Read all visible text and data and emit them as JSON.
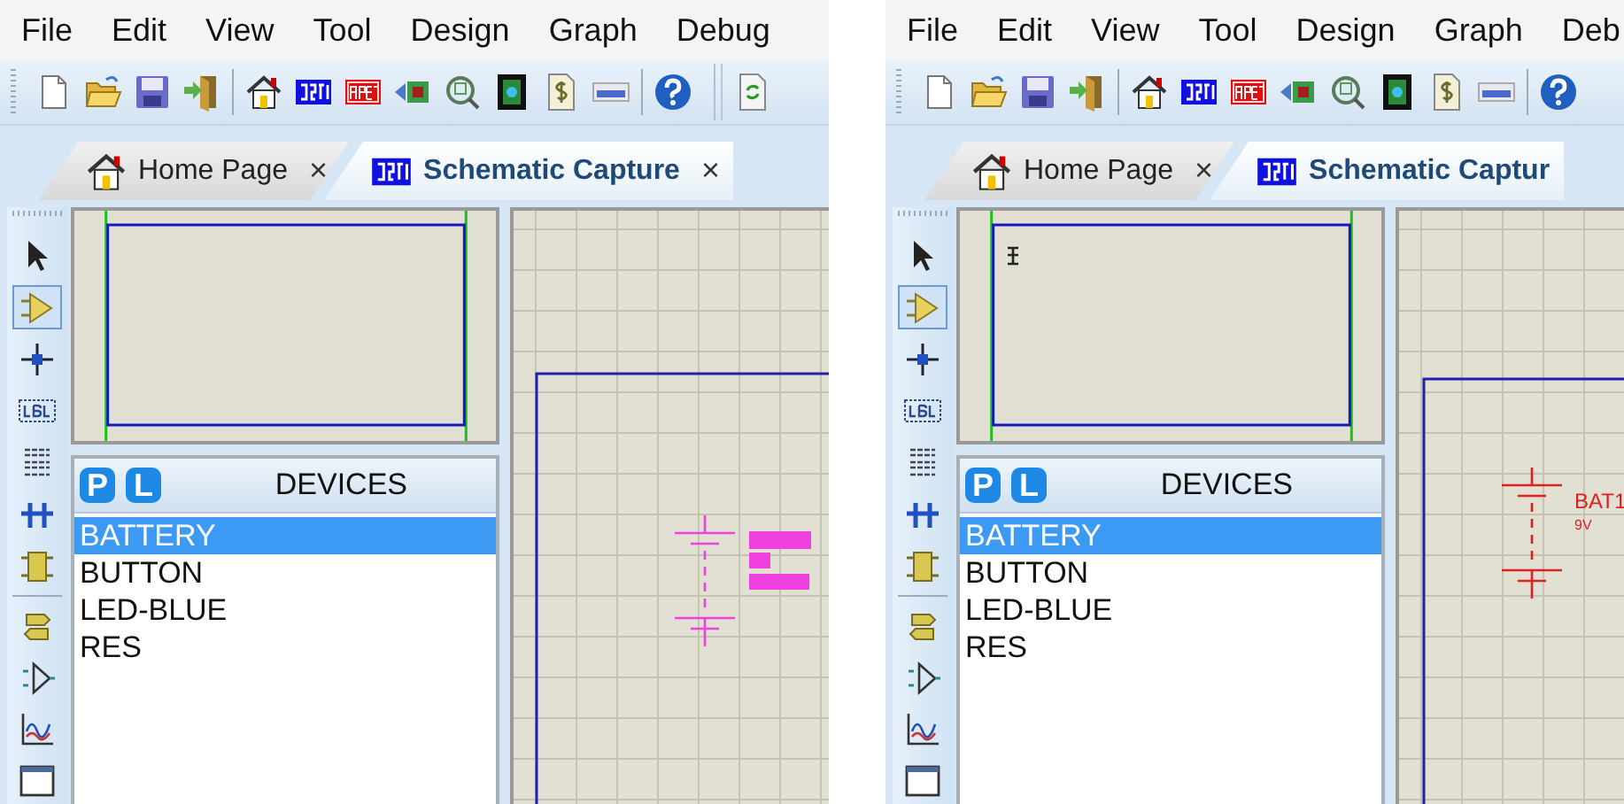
{
  "panes": [
    {
      "menu": [
        "File",
        "Edit",
        "View",
        "Tool",
        "Design",
        "Graph",
        "Debug"
      ],
      "tabs": [
        {
          "kind": "home",
          "label": "Home Page",
          "close": "×",
          "selected": false
        },
        {
          "kind": "isis",
          "label": "Schematic Capture",
          "close": "×",
          "selected": true
        }
      ],
      "tools": [
        {
          "kind": "select",
          "selected": false
        },
        {
          "kind": "component",
          "selected": true
        },
        {
          "kind": "junction",
          "selected": false
        },
        {
          "kind": "label",
          "selected": false
        },
        {
          "kind": "script",
          "selected": false
        },
        {
          "kind": "bus",
          "selected": false
        },
        {
          "kind": "subcircuit",
          "selected": false
        },
        {
          "kind": "terminal",
          "selected": false
        },
        {
          "kind": "pin",
          "selected": false
        },
        {
          "kind": "graph",
          "selected": false
        },
        {
          "kind": "tape",
          "selected": false
        }
      ],
      "overview": {
        "text_cursor": false
      },
      "devices": {
        "pick_button": "P",
        "library_button": "L",
        "title": "DEVICES",
        "items": [
          {
            "label": "BATTERY",
            "selected": true
          },
          {
            "label": "BUTTON",
            "selected": false
          },
          {
            "label": "LED-BLUE",
            "selected": false
          },
          {
            "label": "RES",
            "selected": false
          }
        ]
      },
      "canvas": {
        "component": {
          "kind": "placing"
        }
      }
    },
    {
      "menu": [
        "File",
        "Edit",
        "View",
        "Tool",
        "Design",
        "Graph",
        "Deb"
      ],
      "tabs": [
        {
          "kind": "home",
          "label": "Home Page",
          "close": "×",
          "selected": false
        },
        {
          "kind": "isis",
          "label": "Schematic Captur",
          "selected": true
        }
      ],
      "tools": [
        {
          "kind": "select",
          "selected": false
        },
        {
          "kind": "component",
          "selected": true
        },
        {
          "kind": "junction",
          "selected": false
        },
        {
          "kind": "label",
          "selected": false
        },
        {
          "kind": "script",
          "selected": false
        },
        {
          "kind": "bus",
          "selected": false
        },
        {
          "kind": "subcircuit",
          "selected": false
        },
        {
          "kind": "terminal",
          "selected": false
        },
        {
          "kind": "pin",
          "selected": false
        },
        {
          "kind": "graph",
          "selected": false
        },
        {
          "kind": "tape",
          "selected": false
        }
      ],
      "overview": {
        "text_cursor": true
      },
      "devices": {
        "pick_button": "P",
        "library_button": "L",
        "title": "DEVICES",
        "items": [
          {
            "label": "BATTERY",
            "selected": true
          },
          {
            "label": "BUTTON",
            "selected": false
          },
          {
            "label": "LED-BLUE",
            "selected": false
          },
          {
            "label": "RES",
            "selected": false
          }
        ]
      },
      "canvas": {
        "component": {
          "kind": "placed",
          "name": "BAT1",
          "value": "9V"
        }
      }
    }
  ]
}
